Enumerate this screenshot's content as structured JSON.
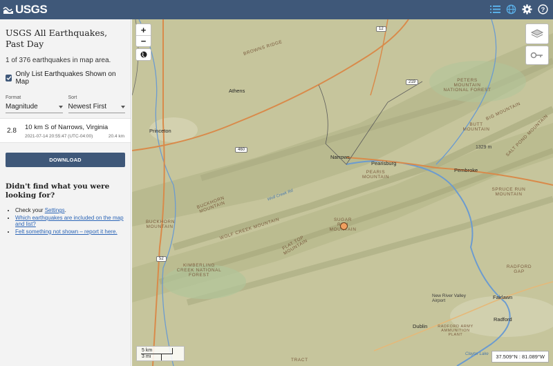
{
  "header": {
    "logo_text": "USGS",
    "icons": [
      "list-icon",
      "globe-icon",
      "gear-icon",
      "help-icon"
    ],
    "bg_color": "#3f5879"
  },
  "sidebar": {
    "title": "USGS All Earthquakes, Past Day",
    "count_text": "1 of 376 earthquakes in map area.",
    "only_list_label": "Only List Earthquakes Shown on Map",
    "only_list_checked": true,
    "format_label": "Format",
    "format_value": "Magnitude",
    "sort_label": "Sort",
    "sort_value": "Newest First",
    "earthquakes": [
      {
        "mag": "2.8",
        "place": "10 km S of Narrows, Virginia",
        "time": "2021-07-14 20:55:47 (UTC-04:00)",
        "depth": "20.4 km"
      }
    ],
    "download_label": "DOWNLOAD",
    "help_title": "Didn't find what you were looking for?",
    "help_check_prefix": "Check your ",
    "help_settings_link": "Settings",
    "help_check_suffix": ".",
    "help_link_included": "Which earthquakes are included on the map and list?",
    "help_link_felt": "Felt something not shown – report it here."
  },
  "map": {
    "zoom_in": "+",
    "zoom_out": "−",
    "scale_km": "5 km",
    "scale_mi": "3 mi",
    "coordinates": "37.509°N : 81.089°W",
    "places": {
      "athens": "Athens",
      "princeton": "Princeton",
      "narrows": "Narrows",
      "pearisburg": "Pearisburg",
      "pembroke": "Pembroke",
      "fairlawn": "Fairlawn",
      "radford": "Radford",
      "dublin": "Dublin",
      "new_river_airport": "New River Valley Airport",
      "peters_forest": "PETERS MOUNTAIN NATIONAL FOREST",
      "kimberling": "KIMBERLING CREEK NATIONAL FOREST",
      "radford_army": "RADFORD ARMY AMMUNITION PLANT"
    },
    "mountains": {
      "browns_ridge": "BROWNS RIDGE",
      "big_mountain": "BIG MOUNTAIN",
      "butt_mountain": "BUTT MOUNTAIN",
      "salt_pond": "SALT POND MOUNTAIN",
      "elev_1329": "1329 m",
      "pearis": "PEARIS MOUNTAIN",
      "spruce_run": "SPRUCE RUN MOUNTAIN",
      "buckhorn": "BUCKHORN MOUNTAIN",
      "wolf_creek": "WOLF CREEK MOUNTAIN",
      "sugar_run": "SUGAR RUN MOUNTAIN",
      "flat_top": "FLAT TOP MOUNTAIN",
      "buckhorn2": "BUCKHORN MOUNTAIN",
      "radford_gap": "RADFORD GAP",
      "tract": "TRACT"
    },
    "water": {
      "wolf_creek_rd": "Wolf Creek Rd",
      "claytor_lake": "Claytor Lake"
    },
    "shields": {
      "r12": "12",
      "r219": "219",
      "r460": "460",
      "r52": "52"
    }
  }
}
